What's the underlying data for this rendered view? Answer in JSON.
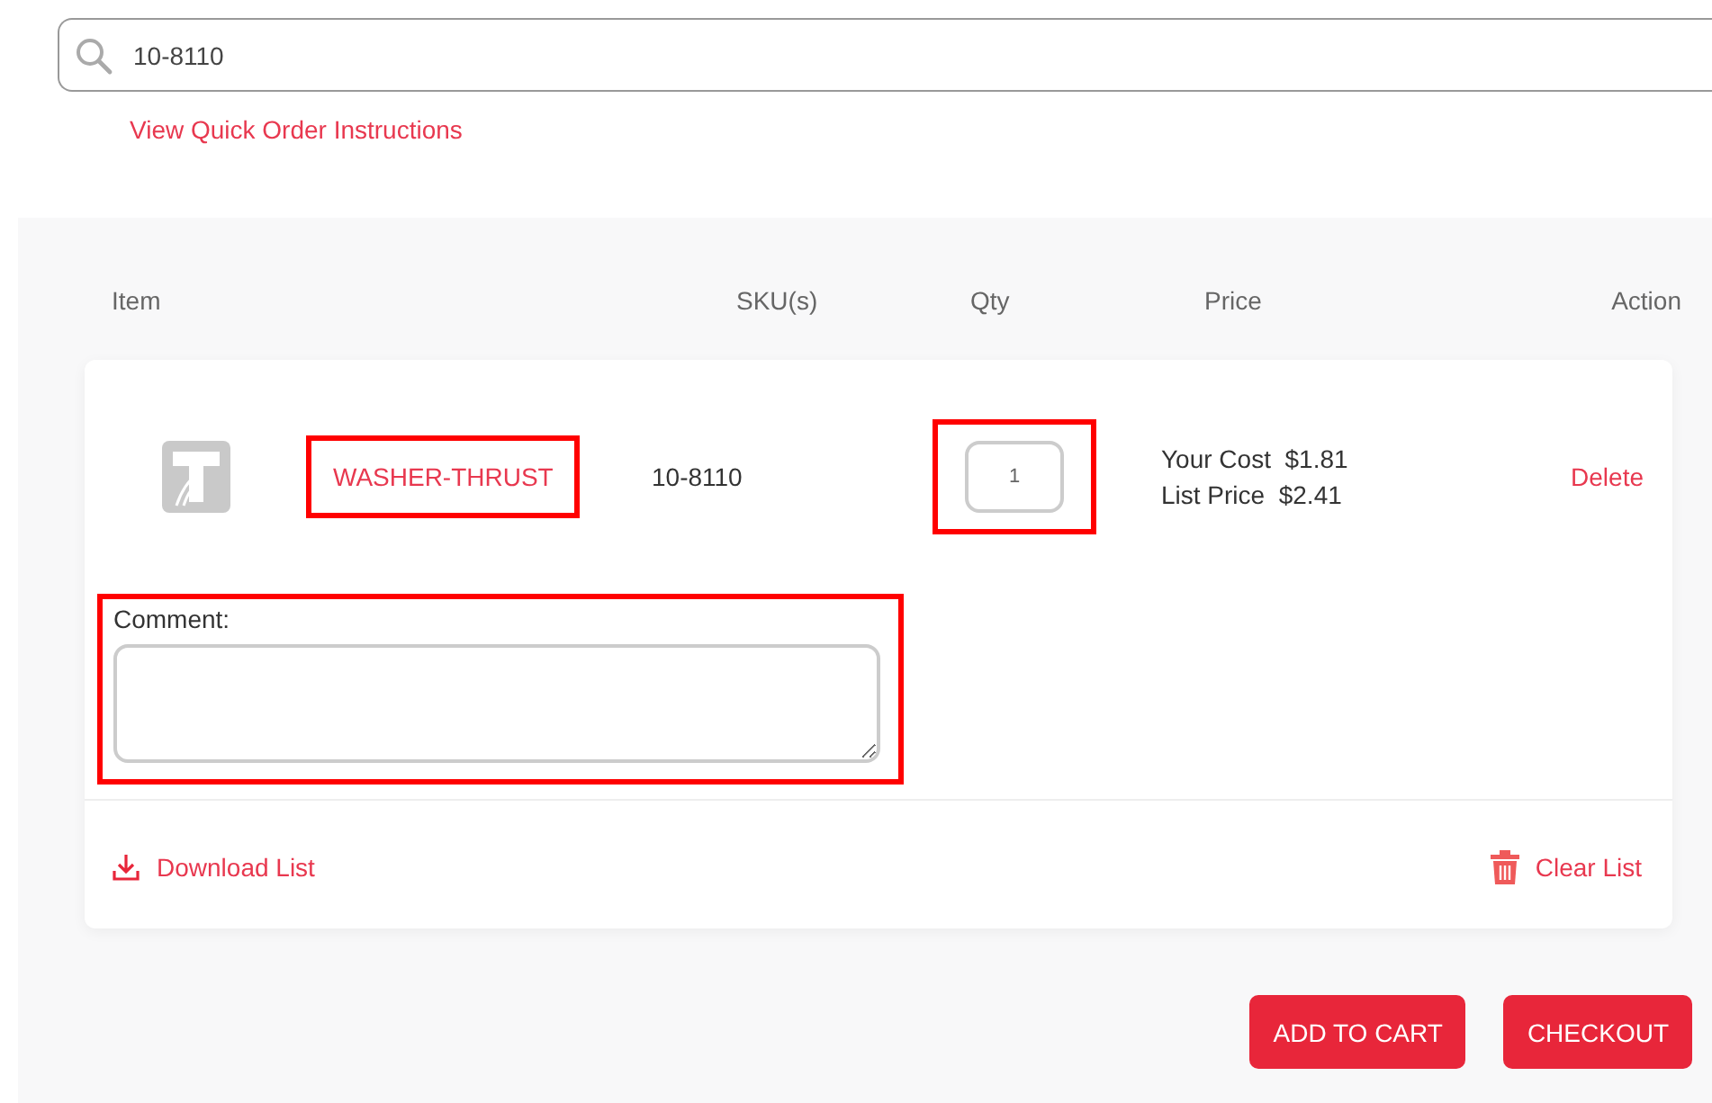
{
  "search": {
    "value": "10-8110"
  },
  "instructions_link": "View Quick Order Instructions",
  "columns": [
    "Item",
    "SKU(s)",
    "Qty",
    "Price",
    "Action"
  ],
  "items": [
    {
      "name": "WASHER-THRUST",
      "name_highlighted": true,
      "sku": "10-8110",
      "qty": "1",
      "qty_highlighted": true,
      "your_cost_label": "Your Cost",
      "your_cost": "$1.81",
      "list_price_label": "List Price",
      "list_price": "$2.41",
      "action": "Delete",
      "comment_label": "Comment:",
      "comment_highlighted": true
    }
  ],
  "download_link": "Download List",
  "clear_link": "Clear List",
  "buttons": [
    "ADD TO CART",
    "CHECKOUT"
  ]
}
